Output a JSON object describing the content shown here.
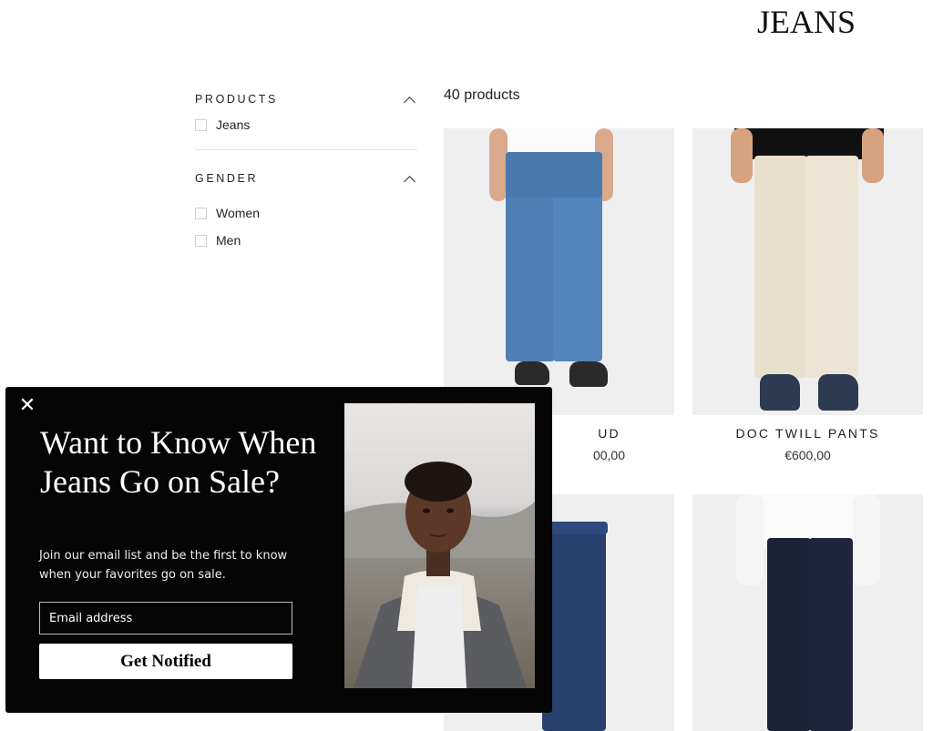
{
  "page": {
    "title": "JEANS"
  },
  "sidebar": {
    "facets": [
      {
        "title": "PRODUCTS",
        "options": [
          "Jeans"
        ]
      },
      {
        "title": "GENDER",
        "options": [
          "Women",
          "Men"
        ]
      }
    ]
  },
  "listing": {
    "count": "40 products",
    "products": [
      {
        "name": "UD",
        "price": "00,00"
      },
      {
        "name": "DOC TWILL PANTS",
        "price": "€600,00"
      }
    ]
  },
  "popup": {
    "close_glyph": "✕",
    "heading": "Want to Know When Jeans Go on Sale?",
    "subtext": "Join our email list and be the first to know when your favorites go on sale.",
    "email_placeholder": "Email address",
    "button_label": "Get Notified"
  },
  "colors": {
    "popup_bg": "#050505",
    "button_bg": "#ffffff",
    "card_bg": "#efefef"
  }
}
